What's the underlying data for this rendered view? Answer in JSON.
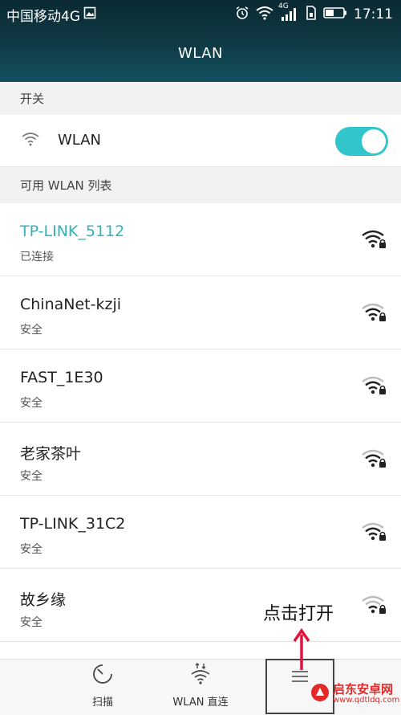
{
  "status_bar": {
    "carrier": "中国移动4G",
    "network_tag": "4G",
    "time": "17:11"
  },
  "header": {
    "title": "WLAN"
  },
  "sections": {
    "switch_label": "开关",
    "list_label": "可用 WLAN 列表"
  },
  "wlan_toggle": {
    "label": "WLAN",
    "enabled": true
  },
  "networks": [
    {
      "name": "TP-LINK_5112",
      "status": "已连接",
      "connected": true
    },
    {
      "name": "ChinaNet-kzji",
      "status": "安全",
      "connected": false
    },
    {
      "name": "FAST_1E30",
      "status": "安全",
      "connected": false
    },
    {
      "name": "老家茶叶",
      "status": "安全",
      "connected": false
    },
    {
      "name": "TP-LINK_31C2",
      "status": "安全",
      "connected": false
    },
    {
      "name": "故乡缘",
      "status": "安全",
      "connected": false
    }
  ],
  "bottom_bar": {
    "scan_label": "扫描",
    "direct_label": "WLAN 直连",
    "menu_label": "更多"
  },
  "annotation": {
    "text": "点击打开"
  },
  "watermark": {
    "brand": "启东安卓网",
    "url": "www.qdtldq.com"
  },
  "colors": {
    "accent": "#32c5cc",
    "connected_text": "#30b3bd",
    "arrow": "#e0143c"
  }
}
